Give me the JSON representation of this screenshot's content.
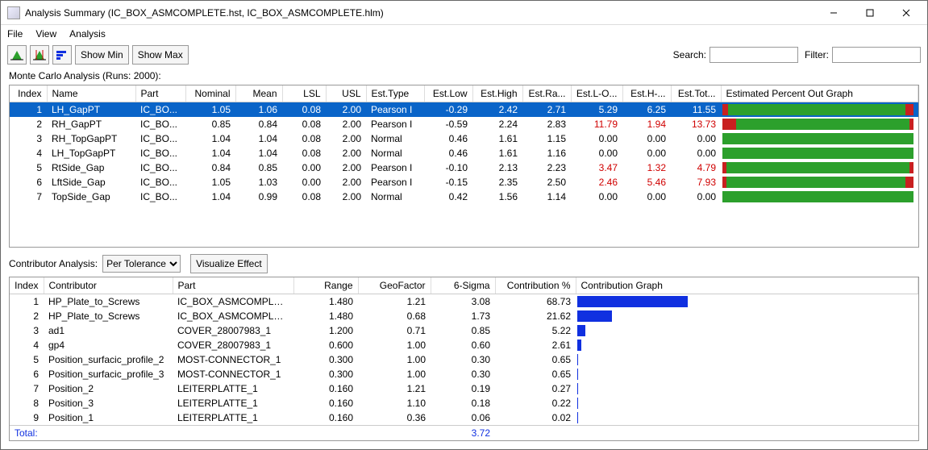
{
  "window": {
    "title": "Analysis Summary (IC_BOX_ASMCOMPLETE.hst, IC_BOX_ASMCOMPLETE.hlm)"
  },
  "menus": {
    "file": "File",
    "view": "View",
    "analysis": "Analysis"
  },
  "toolbar": {
    "show_min": "Show Min",
    "show_max": "Show Max",
    "search_label": "Search:",
    "filter_label": "Filter:",
    "search_value": "",
    "filter_value": ""
  },
  "top": {
    "caption": "Monte Carlo Analysis (Runs: 2000):",
    "headers": {
      "index": "Index",
      "name": "Name",
      "part": "Part",
      "nominal": "Nominal",
      "mean": "Mean",
      "lsl": "LSL",
      "usl": "USL",
      "esttype": "Est.Type",
      "estlow": "Est.Low",
      "esthigh": "Est.High",
      "estra": "Est.Ra...",
      "estlo": "Est.L-O...",
      "esth": "Est.H-...",
      "esttot": "Est.Tot...",
      "graph": "Estimated Percent Out Graph"
    },
    "rows": [
      {
        "idx": "1",
        "name": "LH_GapPT",
        "part": "IC_BO...",
        "nominal": "1.05",
        "mean": "1.06",
        "lsl": "0.08",
        "usl": "2.00",
        "esttype": "Pearson I",
        "estlow": "-0.29",
        "esthigh": "2.42",
        "estra": "2.71",
        "estlo": "5.29",
        "esth": "6.25",
        "esttot": "11.55",
        "redL": 3,
        "redR": 4,
        "sel": true
      },
      {
        "idx": "2",
        "name": "RH_GapPT",
        "part": "IC_BO...",
        "nominal": "0.85",
        "mean": "0.84",
        "lsl": "0.08",
        "usl": "2.00",
        "esttype": "Pearson I",
        "estlow": "-0.59",
        "esthigh": "2.24",
        "estra": "2.83",
        "estlo": "11.79",
        "esth": "1.94",
        "esttot": "13.73",
        "redL": 7,
        "redR": 2,
        "flag": true
      },
      {
        "idx": "3",
        "name": "RH_TopGapPT",
        "part": "IC_BO...",
        "nominal": "1.04",
        "mean": "1.04",
        "lsl": "0.08",
        "usl": "2.00",
        "esttype": "Normal",
        "estlow": "0.46",
        "esthigh": "1.61",
        "estra": "1.15",
        "estlo": "0.00",
        "esth": "0.00",
        "esttot": "0.00",
        "redL": 0,
        "redR": 0
      },
      {
        "idx": "4",
        "name": "LH_TopGapPT",
        "part": "IC_BO...",
        "nominal": "1.04",
        "mean": "1.04",
        "lsl": "0.08",
        "usl": "2.00",
        "esttype": "Normal",
        "estlow": "0.46",
        "esthigh": "1.61",
        "estra": "1.16",
        "estlo": "0.00",
        "esth": "0.00",
        "esttot": "0.00",
        "redL": 0,
        "redR": 0
      },
      {
        "idx": "5",
        "name": "RtSide_Gap",
        "part": "IC_BO...",
        "nominal": "0.84",
        "mean": "0.85",
        "lsl": "0.00",
        "usl": "2.00",
        "esttype": "Pearson I",
        "estlow": "-0.10",
        "esthigh": "2.13",
        "estra": "2.23",
        "estlo": "3.47",
        "esth": "1.32",
        "esttot": "4.79",
        "redL": 2,
        "redR": 2,
        "flag": true
      },
      {
        "idx": "6",
        "name": "LftSide_Gap",
        "part": "IC_BO...",
        "nominal": "1.05",
        "mean": "1.03",
        "lsl": "0.00",
        "usl": "2.00",
        "esttype": "Pearson I",
        "estlow": "-0.15",
        "esthigh": "2.35",
        "estra": "2.50",
        "estlo": "2.46",
        "esth": "5.46",
        "esttot": "7.93",
        "redL": 2,
        "redR": 4,
        "flag": true
      },
      {
        "idx": "7",
        "name": "TopSide_Gap",
        "part": "IC_BO...",
        "nominal": "1.04",
        "mean": "0.99",
        "lsl": "0.08",
        "usl": "2.00",
        "esttype": "Normal",
        "estlow": "0.42",
        "esthigh": "1.56",
        "estra": "1.14",
        "estlo": "0.00",
        "esth": "0.00",
        "esttot": "0.00",
        "redL": 0,
        "redR": 0
      }
    ]
  },
  "mid": {
    "label": "Contributor Analysis:",
    "dropdown_value": "Per Tolerance",
    "visualize": "Visualize Effect"
  },
  "bot": {
    "headers": {
      "index": "Index",
      "contributor": "Contributor",
      "part": "Part",
      "range": "Range",
      "geofactor": "GeoFactor",
      "sixsigma": "6-Sigma",
      "contrib": "Contribution %",
      "graph": "Contribution Graph"
    },
    "rows": [
      {
        "idx": "1",
        "contributor": "HP_Plate_to_Screws",
        "part": "IC_BOX_ASMCOMPLETE",
        "range": "1.480",
        "geofactor": "1.21",
        "sixsigma": "3.08",
        "contrib": "68.73",
        "bar": 68.73
      },
      {
        "idx": "2",
        "contributor": "HP_Plate_to_Screws",
        "part": "IC_BOX_ASMCOMPLETE",
        "range": "1.480",
        "geofactor": "0.68",
        "sixsigma": "1.73",
        "contrib": "21.62",
        "bar": 21.62
      },
      {
        "idx": "3",
        "contributor": "ad1",
        "part": "COVER_28007983_1",
        "range": "1.200",
        "geofactor": "0.71",
        "sixsigma": "0.85",
        "contrib": "5.22",
        "bar": 5.22
      },
      {
        "idx": "4",
        "contributor": "gp4",
        "part": "COVER_28007983_1",
        "range": "0.600",
        "geofactor": "1.00",
        "sixsigma": "0.60",
        "contrib": "2.61",
        "bar": 2.61
      },
      {
        "idx": "5",
        "contributor": "Position_surfacic_profile_2",
        "part": "MOST-CONNECTOR_1",
        "range": "0.300",
        "geofactor": "1.00",
        "sixsigma": "0.30",
        "contrib": "0.65",
        "bar": 0.65
      },
      {
        "idx": "6",
        "contributor": "Position_surfacic_profile_3",
        "part": "MOST-CONNECTOR_1",
        "range": "0.300",
        "geofactor": "1.00",
        "sixsigma": "0.30",
        "contrib": "0.65",
        "bar": 0.65
      },
      {
        "idx": "7",
        "contributor": "Position_2",
        "part": "LEITERPLATTE_1",
        "range": "0.160",
        "geofactor": "1.21",
        "sixsigma": "0.19",
        "contrib": "0.27",
        "bar": 0.27
      },
      {
        "idx": "8",
        "contributor": "Position_3",
        "part": "LEITERPLATTE_1",
        "range": "0.160",
        "geofactor": "1.10",
        "sixsigma": "0.18",
        "contrib": "0.22",
        "bar": 0.22
      },
      {
        "idx": "9",
        "contributor": "Position_1",
        "part": "LEITERPLATTE_1",
        "range": "0.160",
        "geofactor": "0.36",
        "sixsigma": "0.06",
        "contrib": "0.02",
        "bar": 0.02
      }
    ],
    "total_label": "Total:",
    "total_sixsigma": "3.72"
  }
}
